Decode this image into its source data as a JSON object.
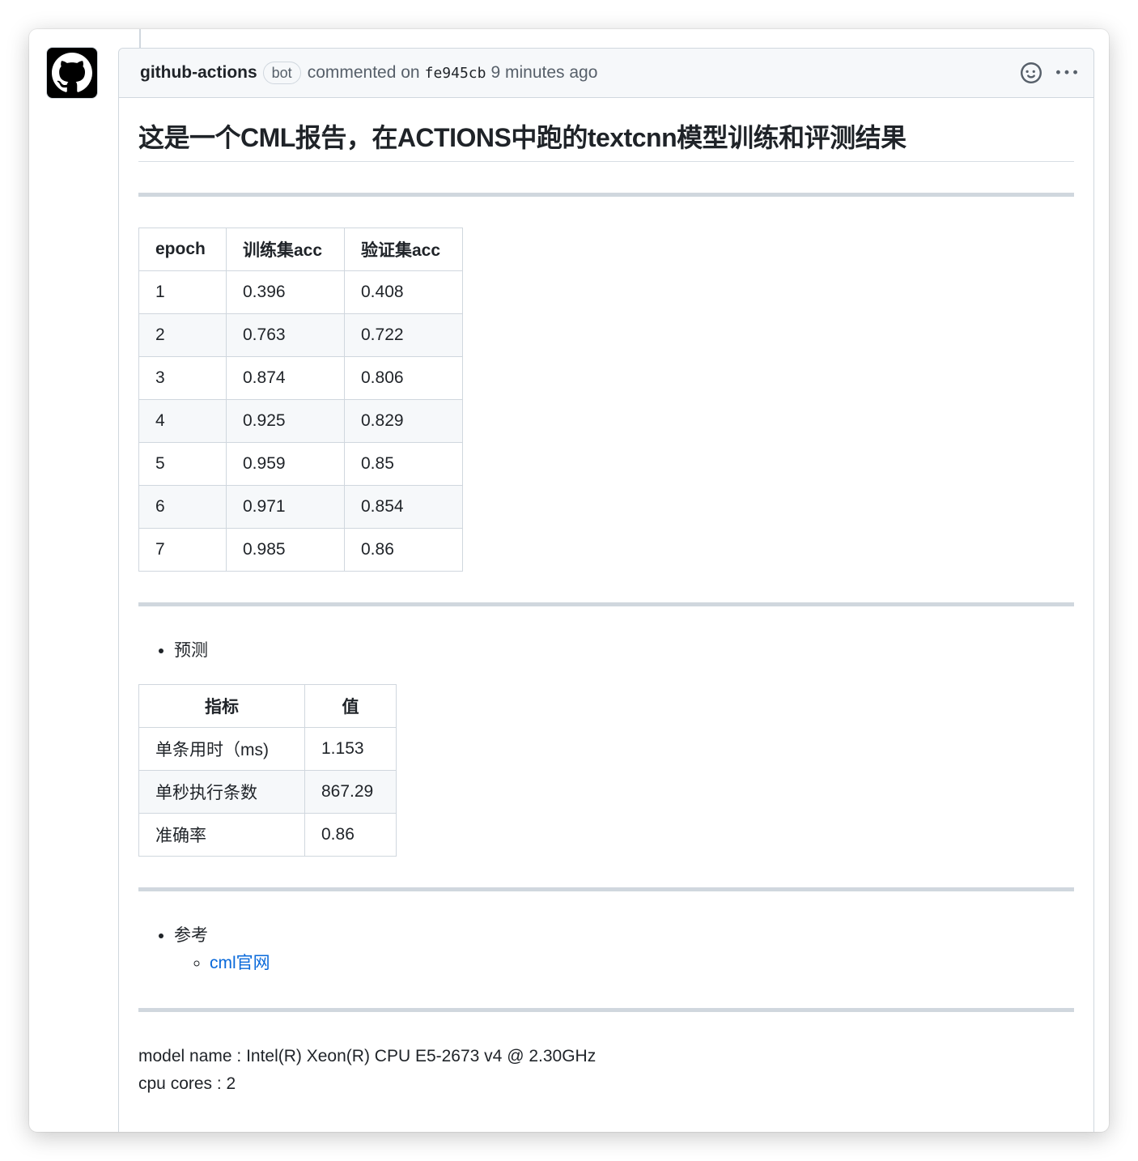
{
  "header": {
    "author": "github-actions",
    "badge": "bot",
    "commented_on": "commented on",
    "sha": "fe945cb",
    "time": "9 minutes ago",
    "reaction_icon": "smiley-icon",
    "menu_icon": "kebab-horizontal-icon"
  },
  "avatar_icon": "github-mark-icon",
  "title": "这是一个CML报告，在ACTIONS中跑的textcnn模型训练和评测结果",
  "training_table": {
    "headers": [
      "epoch",
      "训练集acc",
      "验证集acc"
    ],
    "rows": [
      [
        "1",
        "0.396",
        "0.408"
      ],
      [
        "2",
        "0.763",
        "0.722"
      ],
      [
        "3",
        "0.874",
        "0.806"
      ],
      [
        "4",
        "0.925",
        "0.829"
      ],
      [
        "5",
        "0.959",
        "0.85"
      ],
      [
        "6",
        "0.971",
        "0.854"
      ],
      [
        "7",
        "0.985",
        "0.86"
      ]
    ]
  },
  "predict": {
    "bullet": "预测",
    "headers": [
      "指标",
      "值"
    ],
    "rows": [
      [
        "单条用时（ms)",
        "1.153"
      ],
      [
        "单秒执行条数",
        "867.29"
      ],
      [
        "准确率",
        "0.86"
      ]
    ]
  },
  "reference": {
    "bullet": "参考",
    "link_label": "cml官网"
  },
  "info": {
    "model_name": "model name : Intel(R) Xeon(R) CPU E5-2673 v4 @ 2.30GHz",
    "cpu_cores": "cpu cores : 2"
  }
}
